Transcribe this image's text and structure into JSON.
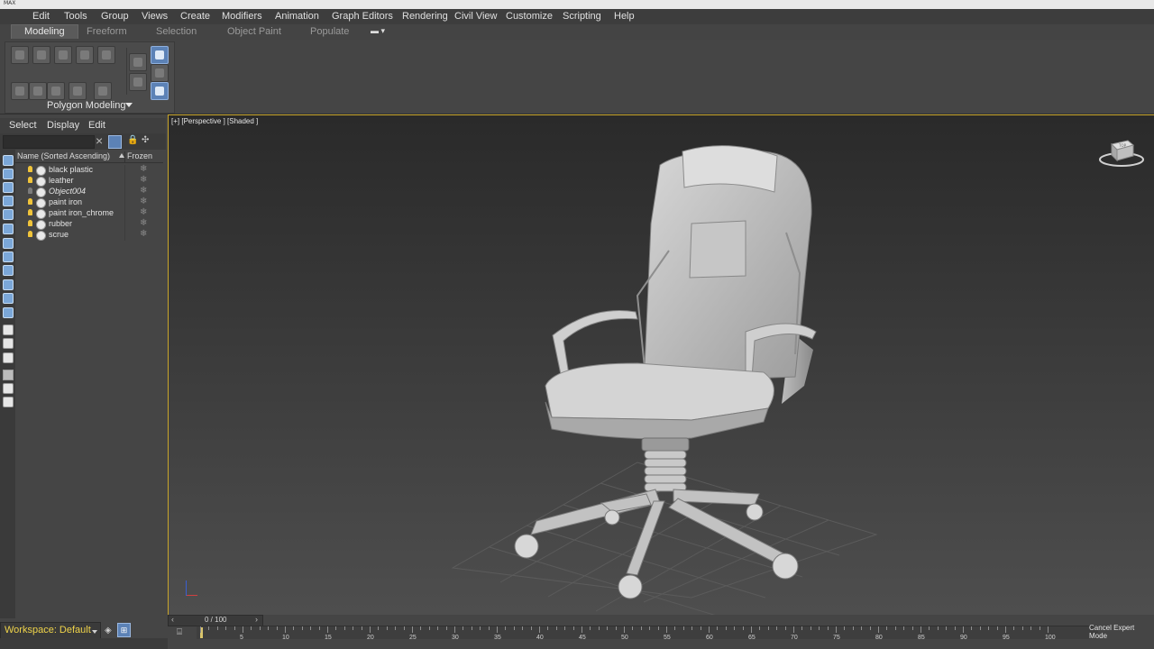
{
  "menu": [
    "Edit",
    "Tools",
    "Group",
    "Views",
    "Create",
    "Modifiers",
    "Animation",
    "Graph Editors",
    "Rendering",
    "Civil View",
    "Customize",
    "Scripting",
    "Help"
  ],
  "ribbon_tabs": [
    "Modeling",
    "Freeform",
    "Selection",
    "Object Paint",
    "Populate"
  ],
  "ribbon": {
    "panel_label": "Polygon Modeling"
  },
  "scene_explorer": {
    "tabs": [
      "Select",
      "Display",
      "Edit"
    ],
    "col_name": "Name (Sorted Ascending)",
    "col_frozen": "Frozen",
    "rows": [
      {
        "name": "black plastic",
        "light": true,
        "italic": false
      },
      {
        "name": "leather",
        "light": true,
        "italic": false
      },
      {
        "name": "Object004",
        "light": false,
        "italic": true
      },
      {
        "name": "paint iron",
        "light": true,
        "italic": false
      },
      {
        "name": "paint iron_chrome",
        "light": true,
        "italic": false
      },
      {
        "name": "rubber",
        "light": true,
        "italic": false
      },
      {
        "name": "scrue",
        "light": true,
        "italic": false
      }
    ]
  },
  "viewport": {
    "label": "[+] [Perspective ] [Shaded ]",
    "viewcube_label": "TOP"
  },
  "timeline": {
    "frame_display": "0 / 100",
    "ticks": [
      0,
      5,
      10,
      15,
      20,
      25,
      30,
      35,
      40,
      45,
      50,
      55,
      60,
      65,
      70,
      75,
      80,
      85,
      90,
      95,
      100
    ],
    "tick_labels": [
      "5",
      "10",
      "15",
      "20",
      "25",
      "30",
      "35",
      "40",
      "45",
      "50",
      "55",
      "60",
      "65",
      "70",
      "75",
      "80",
      "85",
      "90",
      "95",
      "100"
    ]
  },
  "status": {
    "workspace": "Workspace: Default",
    "expert_mode": "Cancel Expert Mode"
  }
}
